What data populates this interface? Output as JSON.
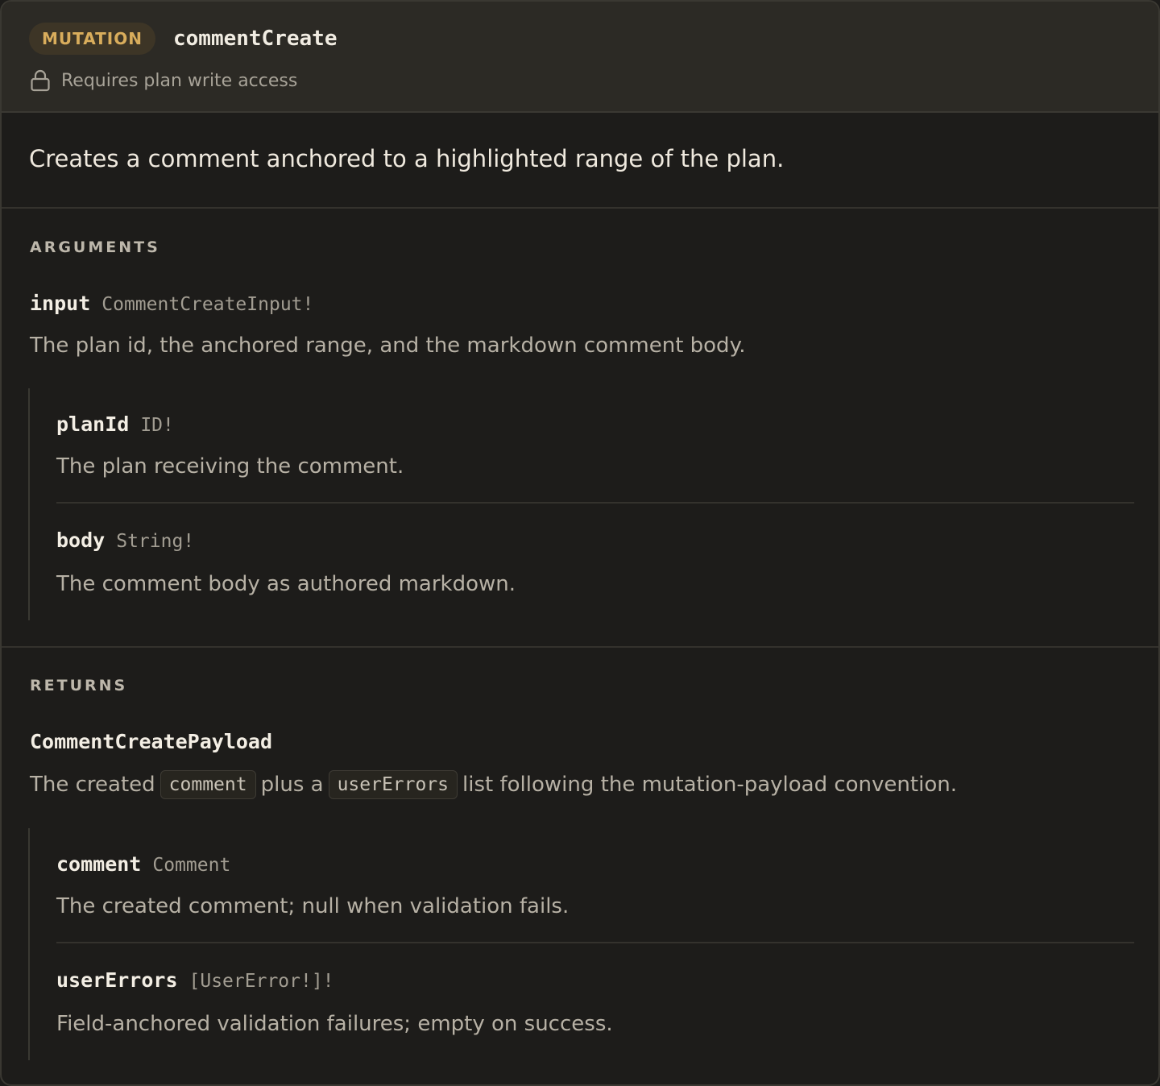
{
  "header": {
    "badge": "MUTATION",
    "operation_name": "commentCreate",
    "access_note": "Requires plan write access",
    "colors": {
      "badge_bg": "#3d3526",
      "badge_text": "#d9ad5c",
      "header_bg": "#2c2a25"
    }
  },
  "summary": "Creates a comment anchored to a highlighted range of the plan.",
  "arguments": {
    "label": "ARGUMENTS",
    "input": {
      "name": "input",
      "type": "CommentCreateInput!",
      "description": "The plan id, the anchored range, and the markdown comment body.",
      "fields": [
        {
          "name": "planId",
          "type": "ID!",
          "description": "The plan receiving the comment."
        },
        {
          "name": "body",
          "type": "String!",
          "description": "The comment body as authored markdown."
        }
      ]
    }
  },
  "returns": {
    "label": "RETURNS",
    "type_name": "CommentCreatePayload",
    "description_parts": {
      "before": "The created",
      "code1": "comment",
      "middle": "plus a",
      "code2": "userErrors",
      "after": "list following the mutation-payload convention."
    },
    "fields": [
      {
        "name": "comment",
        "type": "Comment",
        "description": "The created comment; null when validation fails."
      },
      {
        "name": "userErrors",
        "type": "[UserError!]!",
        "description": "Field-anchored validation failures; empty on success."
      }
    ]
  },
  "icons": {
    "access": "lock-icon"
  }
}
